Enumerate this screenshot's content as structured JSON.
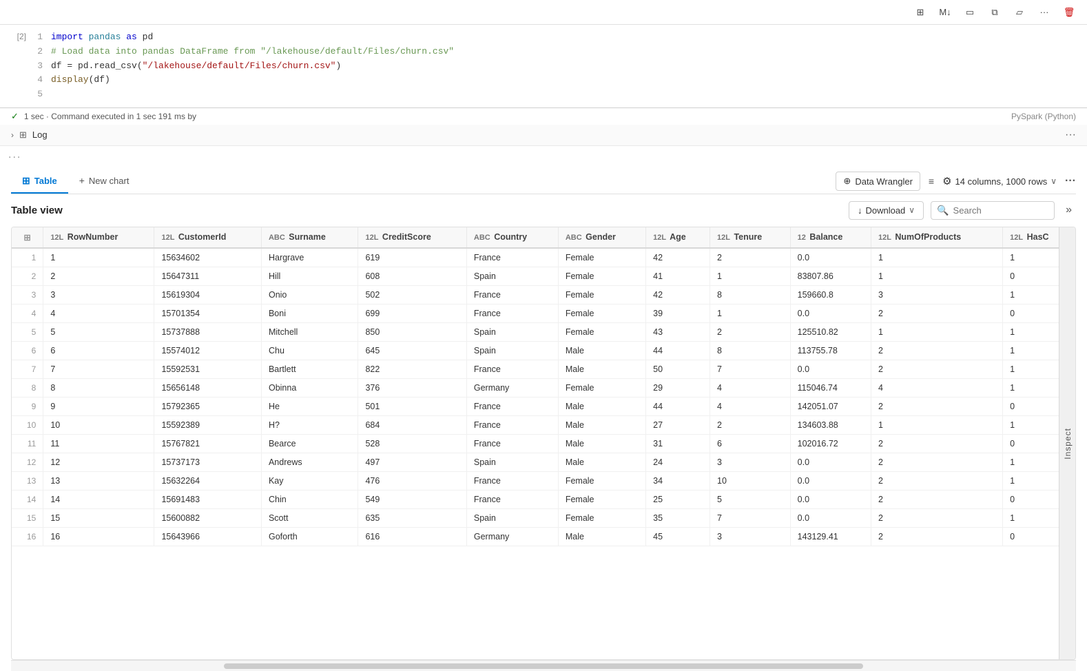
{
  "toolbar": {
    "icons": [
      "layout-icon",
      "markdown-icon",
      "display-icon",
      "copy-icon",
      "comment-icon",
      "more-icon",
      "delete-icon"
    ]
  },
  "cell": {
    "number": "[2]",
    "lines": [
      {
        "num": 1,
        "content": "import pandas as pd"
      },
      {
        "num": 2,
        "content": "# Load data into pandas DataFrame from \"/lakehouse/default/Files/churn.csv\""
      },
      {
        "num": 3,
        "content": "df = pd.read_csv(\"/lakehouse/default/Files/churn.csv\")"
      },
      {
        "num": 4,
        "content": "display(df)"
      },
      {
        "num": 5,
        "content": ""
      }
    ],
    "execution_status": "✓  1 sec · Command executed in 1 sec 191 ms by",
    "runtime": "PySpark (Python)"
  },
  "log": {
    "label": "Log"
  },
  "dots": "...",
  "tabs": {
    "items": [
      {
        "id": "table",
        "label": "Table",
        "active": true
      },
      {
        "id": "new-chart",
        "label": "New chart",
        "active": false
      }
    ]
  },
  "data_wrangler": {
    "label": "Data Wrangler"
  },
  "settings": {
    "label": "14 columns, 1000 rows"
  },
  "table_view": {
    "title": "Table view",
    "download_label": "Download",
    "search_placeholder": "Search"
  },
  "columns": [
    {
      "name": "RowNumber",
      "type": "12L"
    },
    {
      "name": "CustomerId",
      "type": "12L"
    },
    {
      "name": "Surname",
      "type": "ABC"
    },
    {
      "name": "CreditScore",
      "type": "12L"
    },
    {
      "name": "Country",
      "type": "ABC"
    },
    {
      "name": "Gender",
      "type": "ABC"
    },
    {
      "name": "Age",
      "type": "12L"
    },
    {
      "name": "Tenure",
      "type": "12L"
    },
    {
      "name": "Balance",
      "type": "12"
    },
    {
      "name": "NumOfProducts",
      "type": "12L"
    },
    {
      "name": "HasC",
      "type": "12L"
    }
  ],
  "rows": [
    {
      "idx": 1,
      "RowNumber": 1,
      "CustomerId": 15634602,
      "Surname": "Hargrave",
      "CreditScore": 619,
      "Country": "France",
      "Gender": "Female",
      "Age": 42,
      "Tenure": 2,
      "Balance": "0.0",
      "NumOfProducts": 1,
      "HasC": 1
    },
    {
      "idx": 2,
      "RowNumber": 2,
      "CustomerId": 15647311,
      "Surname": "Hill",
      "CreditScore": 608,
      "Country": "Spain",
      "Gender": "Female",
      "Age": 41,
      "Tenure": 1,
      "Balance": "83807.86",
      "NumOfProducts": 1,
      "HasC": 0
    },
    {
      "idx": 3,
      "RowNumber": 3,
      "CustomerId": 15619304,
      "Surname": "Onio",
      "CreditScore": 502,
      "Country": "France",
      "Gender": "Female",
      "Age": 42,
      "Tenure": 8,
      "Balance": "159660.8",
      "NumOfProducts": 3,
      "HasC": 1
    },
    {
      "idx": 4,
      "RowNumber": 4,
      "CustomerId": 15701354,
      "Surname": "Boni",
      "CreditScore": 699,
      "Country": "France",
      "Gender": "Female",
      "Age": 39,
      "Tenure": 1,
      "Balance": "0.0",
      "NumOfProducts": 2,
      "HasC": 0
    },
    {
      "idx": 5,
      "RowNumber": 5,
      "CustomerId": 15737888,
      "Surname": "Mitchell",
      "CreditScore": 850,
      "Country": "Spain",
      "Gender": "Female",
      "Age": 43,
      "Tenure": 2,
      "Balance": "125510.82",
      "NumOfProducts": 1,
      "HasC": 1
    },
    {
      "idx": 6,
      "RowNumber": 6,
      "CustomerId": 15574012,
      "Surname": "Chu",
      "CreditScore": 645,
      "Country": "Spain",
      "Gender": "Male",
      "Age": 44,
      "Tenure": 8,
      "Balance": "113755.78",
      "NumOfProducts": 2,
      "HasC": 1
    },
    {
      "idx": 7,
      "RowNumber": 7,
      "CustomerId": 15592531,
      "Surname": "Bartlett",
      "CreditScore": 822,
      "Country": "France",
      "Gender": "Male",
      "Age": 50,
      "Tenure": 7,
      "Balance": "0.0",
      "NumOfProducts": 2,
      "HasC": 1
    },
    {
      "idx": 8,
      "RowNumber": 8,
      "CustomerId": 15656148,
      "Surname": "Obinna",
      "CreditScore": 376,
      "Country": "Germany",
      "Gender": "Female",
      "Age": 29,
      "Tenure": 4,
      "Balance": "115046.74",
      "NumOfProducts": 4,
      "HasC": 1
    },
    {
      "idx": 9,
      "RowNumber": 9,
      "CustomerId": 15792365,
      "Surname": "He",
      "CreditScore": 501,
      "Country": "France",
      "Gender": "Male",
      "Age": 44,
      "Tenure": 4,
      "Balance": "142051.07",
      "NumOfProducts": 2,
      "HasC": 0
    },
    {
      "idx": 10,
      "RowNumber": 10,
      "CustomerId": 15592389,
      "Surname": "H?",
      "CreditScore": 684,
      "Country": "France",
      "Gender": "Male",
      "Age": 27,
      "Tenure": 2,
      "Balance": "134603.88",
      "NumOfProducts": 1,
      "HasC": 1
    },
    {
      "idx": 11,
      "RowNumber": 11,
      "CustomerId": 15767821,
      "Surname": "Bearce",
      "CreditScore": 528,
      "Country": "France",
      "Gender": "Male",
      "Age": 31,
      "Tenure": 6,
      "Balance": "102016.72",
      "NumOfProducts": 2,
      "HasC": 0
    },
    {
      "idx": 12,
      "RowNumber": 12,
      "CustomerId": 15737173,
      "Surname": "Andrews",
      "CreditScore": 497,
      "Country": "Spain",
      "Gender": "Male",
      "Age": 24,
      "Tenure": 3,
      "Balance": "0.0",
      "NumOfProducts": 2,
      "HasC": 1
    },
    {
      "idx": 13,
      "RowNumber": 13,
      "CustomerId": 15632264,
      "Surname": "Kay",
      "CreditScore": 476,
      "Country": "France",
      "Gender": "Female",
      "Age": 34,
      "Tenure": 10,
      "Balance": "0.0",
      "NumOfProducts": 2,
      "HasC": 1
    },
    {
      "idx": 14,
      "RowNumber": 14,
      "CustomerId": 15691483,
      "Surname": "Chin",
      "CreditScore": 549,
      "Country": "France",
      "Gender": "Female",
      "Age": 25,
      "Tenure": 5,
      "Balance": "0.0",
      "NumOfProducts": 2,
      "HasC": 0
    },
    {
      "idx": 15,
      "RowNumber": 15,
      "CustomerId": 15600882,
      "Surname": "Scott",
      "CreditScore": 635,
      "Country": "Spain",
      "Gender": "Female",
      "Age": 35,
      "Tenure": 7,
      "Balance": "0.0",
      "NumOfProducts": 2,
      "HasC": 1
    },
    {
      "idx": 16,
      "RowNumber": 16,
      "CustomerId": 15643966,
      "Surname": "Goforth",
      "CreditScore": 616,
      "Country": "Germany",
      "Gender": "Male",
      "Age": 45,
      "Tenure": 3,
      "Balance": "143129.41",
      "NumOfProducts": 2,
      "HasC": 0
    }
  ]
}
